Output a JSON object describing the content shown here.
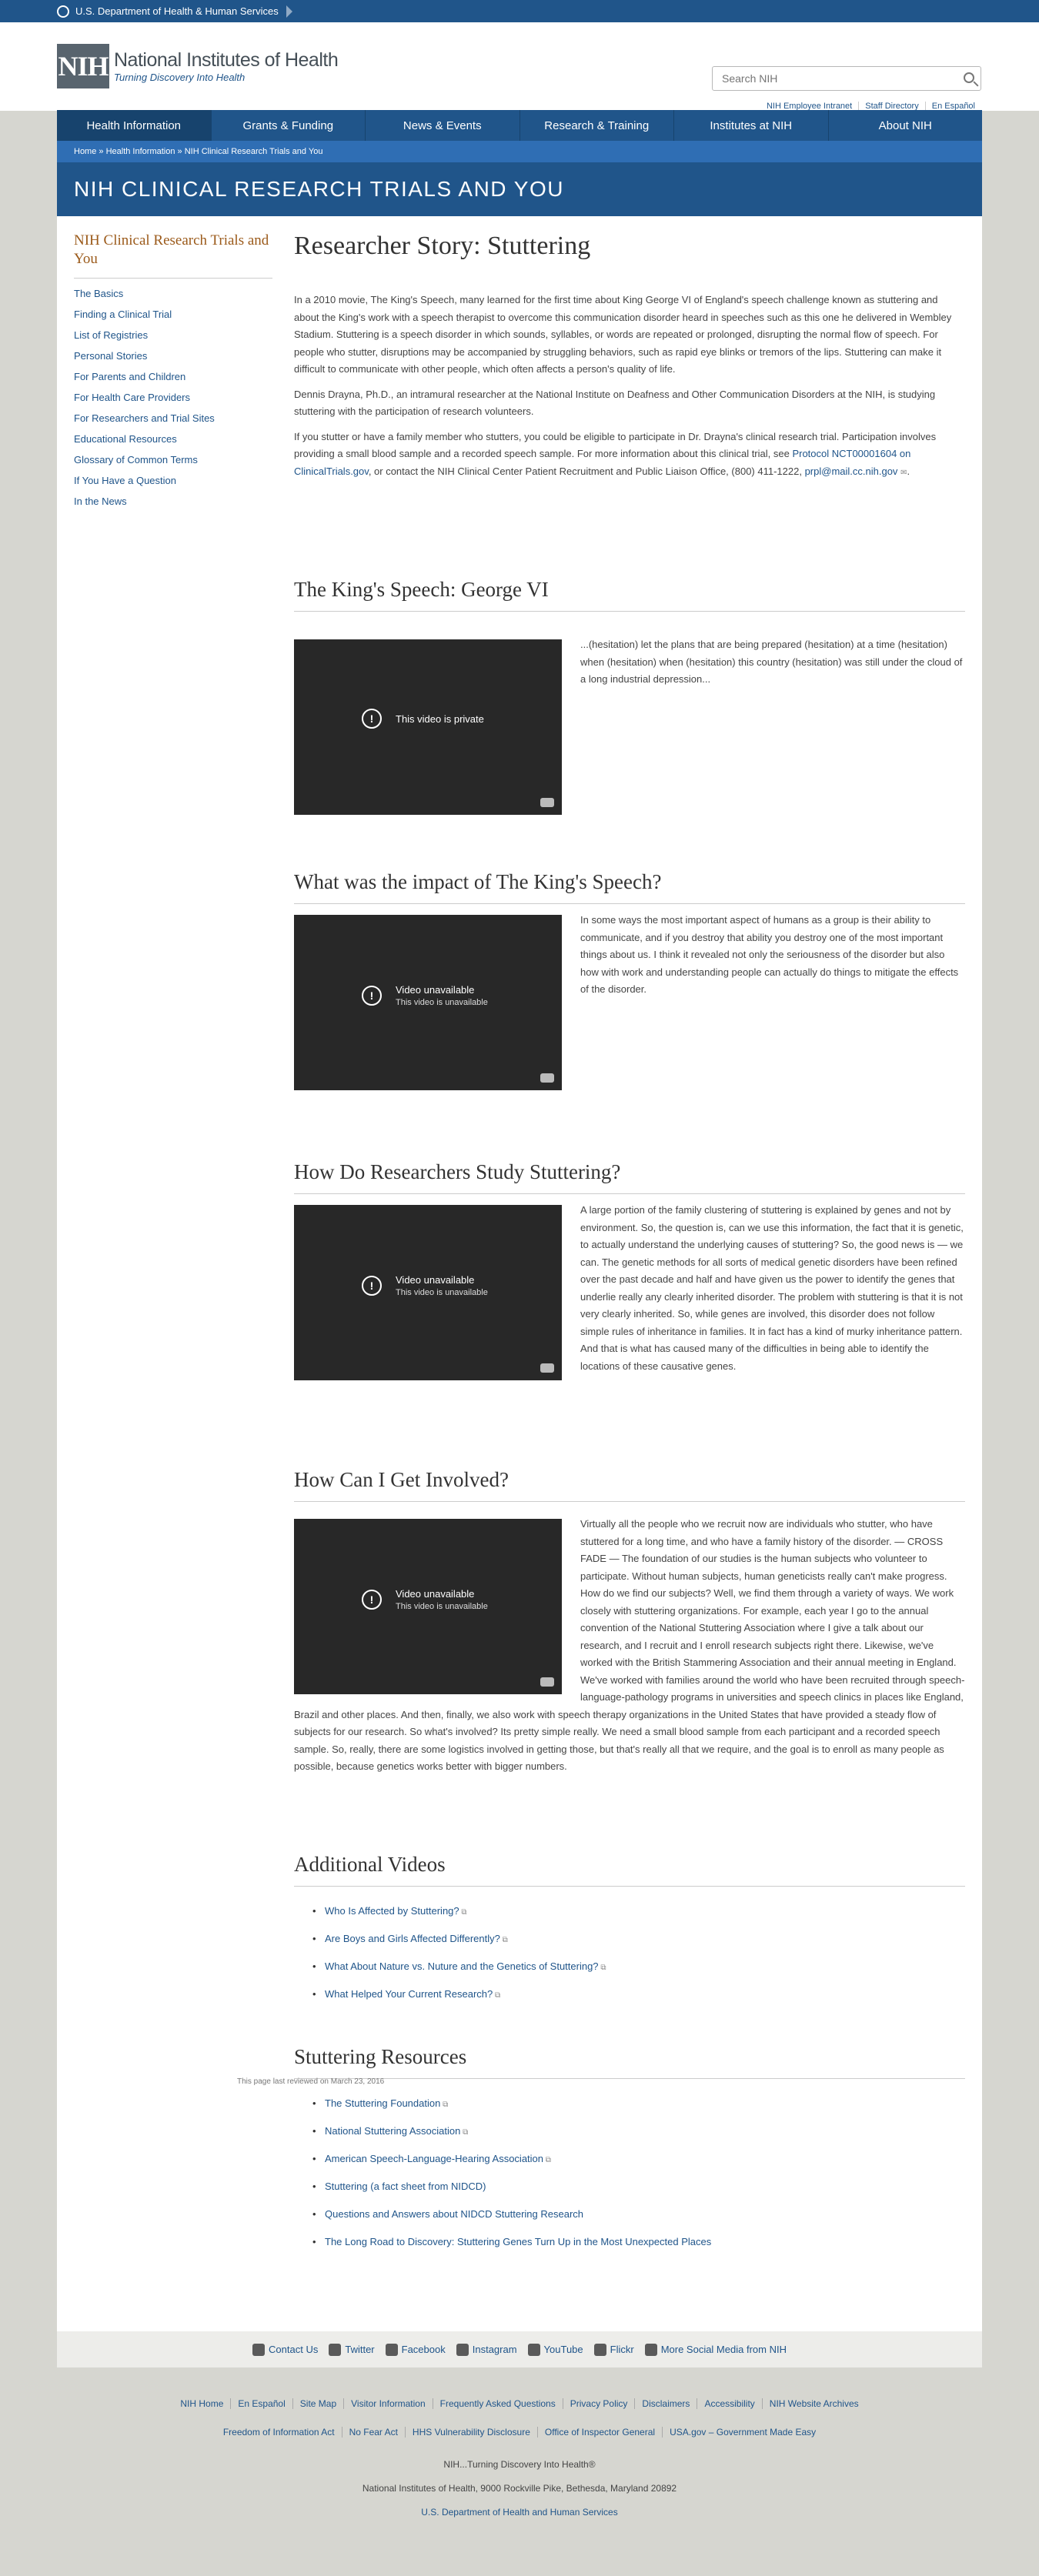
{
  "hhs_bar": {
    "label": "U.S. Department of Health & Human Services"
  },
  "header": {
    "logo_mark": "NIH",
    "logo_title": "National Institutes of Health",
    "logo_tagline": "Turning Discovery Into Health",
    "search_placeholder": "Search NIH",
    "util_links": [
      "NIH Employee Intranet",
      "Staff Directory",
      "En Español"
    ]
  },
  "nav": {
    "items": [
      "Health Information",
      "Grants & Funding",
      "News & Events",
      "Research & Training",
      "Institutes at NIH",
      "About NIH"
    ],
    "active": "Health Information"
  },
  "breadcrumb": [
    "Home",
    "Health Information",
    "NIH Clinical Research Trials and You"
  ],
  "banner_title": "NIH CLINICAL RESEARCH TRIALS AND YOU",
  "sidebar": {
    "title": "NIH Clinical Research Trials and You",
    "items": [
      "The Basics",
      "Finding a Clinical Trial",
      "List of Registries",
      "Personal Stories",
      "For Parents and Children",
      "For Health Care Providers",
      "For Researchers and Trial Sites",
      "Educational Resources",
      "Glossary of Common Terms",
      "If You Have a Question",
      "In the News"
    ]
  },
  "main": {
    "title": "Researcher Story: Stuttering",
    "intro_p1": "In a 2010 movie, The King's Speech, many learned for the first time about King George VI of England's speech challenge known as stuttering and about the King's work with a speech therapist to overcome this communication disorder heard in speeches such as this one he delivered in Wembley Stadium. Stuttering is a speech disorder in which sounds, syllables, or words are repeated or prolonged, disrupting the normal flow of speech. For people who stutter, disruptions may be accompanied by struggling behaviors, such as rapid eye blinks or tremors of the lips. Stuttering can make it difficult to communicate with other people, which often affects a person's quality of life.",
    "intro_p2": "Dennis Drayna, Ph.D., an intramural researcher at the National Institute on Deafness and Other Communication Disorders at the NIH, is studying stuttering with the participation of research volunteers.",
    "intro_p3_a": "If you stutter or have a family member who stutters, you could be eligible to participate in Dr. Drayna's clinical research trial. Participation involves providing a small blood sample and a recorded speech sample. For more information about this clinical trial, see ",
    "intro_p3_link1": "Protocol NCT00001604 on ClinicalTrials.gov",
    "intro_p3_b": ", or contact the NIH Clinical Center Patient Recruitment and Public Liaison Office, (800) 411-1222, ",
    "intro_p3_link2": "prpl@mail.cc.nih.gov",
    "intro_p3_c": "."
  },
  "sections": [
    {
      "heading": "The King's Speech: George VI",
      "video_title": "This video is private",
      "video_sub": "",
      "text": "...(hesitation) let the plans that are being prepared (hesitation) at a time (hesitation) when (hesitation) when (hesitation) this country (hesitation) was still under the cloud of a long industrial depression..."
    },
    {
      "heading": "What was the impact of The King's Speech?",
      "video_title": "Video unavailable",
      "video_sub": "This video is unavailable",
      "text": "In some ways the most important aspect of humans as a group is their ability to communicate, and if you destroy that ability you destroy one of the most important things about us. I think it revealed not only the seriousness of the disorder but also how with work and understanding people can actually do things to mitigate the effects of the disorder."
    },
    {
      "heading": "How Do Researchers Study Stuttering?",
      "video_title": "Video unavailable",
      "video_sub": "This video is unavailable",
      "text": "A large portion of the family clustering of stuttering is explained by genes and not by environment. So, the question is, can we use this information, the fact that it is genetic, to actually understand the underlying causes of stuttering? So, the good news is — we can. The genetic methods for all sorts of medical genetic disorders have been refined over the past decade and half and have given us the power to identify the genes that underlie really any clearly inherited disorder. The problem with stuttering is that it is not very clearly inherited. So, while genes are involved, this disorder does not follow simple rules of inheritance in families. It in fact has a kind of murky inheritance pattern. And that is what has caused many of the difficulties in being able to identify the locations of these causative genes."
    },
    {
      "heading": "How Can I Get Involved?",
      "video_title": "Video unavailable",
      "video_sub": "This video is unavailable",
      "text": "Virtually all the people who we recruit now are individuals who stutter, who have stuttered for a long time, and who have a family history of the disorder. — CROSS FADE — The foundation of our studies is the human subjects who volunteer to participate. Without human subjects, human geneticists really can't make progress. How do we find our subjects? Well, we find them through a variety of ways. We work closely with stuttering organizations. For example, each year I go to the annual convention of the National Stuttering Association where I give a talk about our research, and I recruit and I enroll research subjects right there. Likewise, we've worked with the British Stammering Association and their annual meeting in England. We've worked with families around the world who have been recruited through speech-language-pathology programs in universities and speech clinics in places like England, Brazil and other places. And then, finally, we also work with speech therapy organizations in the United States that have provided a steady flow of subjects for our research. So what's involved? Its pretty simple really. We need a small blood sample from each participant and a recorded speech sample. So, really, there are some logistics involved in getting those, but that's really all that we require, and the goal is to enroll as many people as possible, because genetics works better with bigger numbers."
    }
  ],
  "additional_videos": {
    "heading": "Additional Videos",
    "items": [
      "Who Is Affected by Stuttering?",
      "Are Boys and Girls Affected Differently?",
      "What About Nature vs. Nuture and the Genetics of Stuttering?",
      "What Helped Your Current Research?"
    ]
  },
  "resources": {
    "heading": "Stuttering Resources",
    "items": [
      "The Stuttering Foundation",
      "National Stuttering Association",
      "American Speech-Language-Hearing Association",
      "Stuttering (a fact sheet from NIDCD)",
      "Questions and Answers about NIDCD Stuttering Research",
      "The Long Road to Discovery: Stuttering Genes Turn Up in the Most Unexpected Places"
    ]
  },
  "reviewed": "This page last reviewed on March 23, 2016",
  "social": [
    "Contact Us",
    "Twitter",
    "Facebook",
    "Instagram",
    "YouTube",
    "Flickr",
    "More Social Media from NIH"
  ],
  "footer": {
    "row1": [
      "NIH Home",
      "En Español",
      "Site Map",
      "Visitor Information",
      "Frequently Asked Questions",
      "Privacy Policy",
      "Disclaimers",
      "Accessibility",
      "NIH Website Archives"
    ],
    "row2": [
      "Freedom of Information Act",
      "No Fear Act",
      "HHS Vulnerability Disclosure",
      "Office of Inspector General",
      "USA.gov – Government Made Easy"
    ],
    "tagline": "NIH...Turning Discovery Into Health®",
    "address": "National Institutes of Health, 9000 Rockville Pike, Bethesda, Maryland 20892",
    "hhs_link": "U.S. Department of Health and Human Services"
  }
}
